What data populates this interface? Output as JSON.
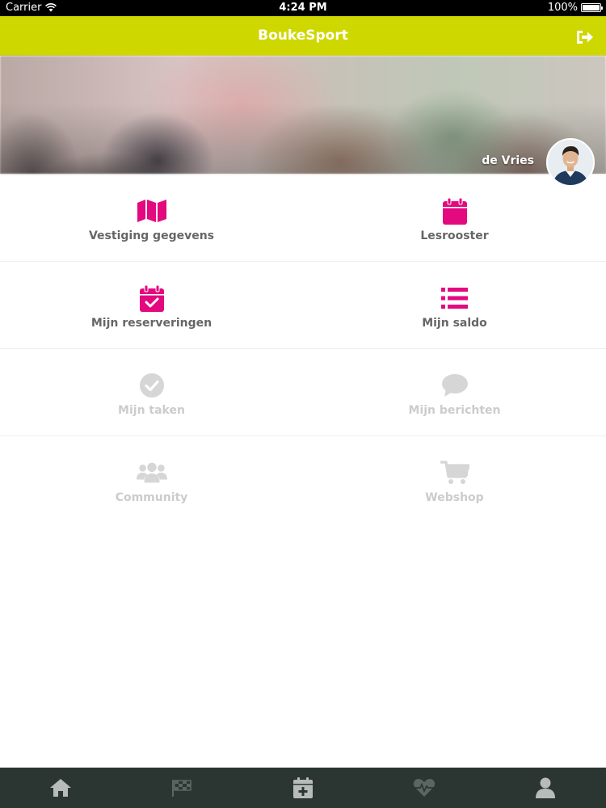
{
  "status_bar": {
    "carrier": "Carrier",
    "time": "4:24 PM",
    "battery": "100%"
  },
  "nav_bar": {
    "title": "BoukeSport",
    "logout_icon": "sign-out-icon",
    "color": "#cfd700"
  },
  "hero": {
    "user_name": "de Vries",
    "avatar_icon": "user-photo"
  },
  "accent_color": "#e3097f",
  "disabled_color": "#d6d6d6",
  "menu": [
    {
      "label": "Vestiging gegevens",
      "icon": "map-icon",
      "enabled": true
    },
    {
      "label": "Lesrooster",
      "icon": "calendar-icon",
      "enabled": true
    },
    {
      "label": "Mijn reserveringen",
      "icon": "calendar-check-icon",
      "enabled": true
    },
    {
      "label": "Mijn saldo",
      "icon": "list-icon",
      "enabled": true
    },
    {
      "label": "Mijn taken",
      "icon": "check-circle-icon",
      "enabled": false
    },
    {
      "label": "Mijn berichten",
      "icon": "chat-icon",
      "enabled": false
    },
    {
      "label": "Community",
      "icon": "users-icon",
      "enabled": false
    },
    {
      "label": "Webshop",
      "icon": "cart-icon",
      "enabled": false
    }
  ],
  "tab_bar": {
    "tabs": [
      {
        "icon": "home-icon",
        "active": true
      },
      {
        "icon": "flag-icon",
        "active": false
      },
      {
        "icon": "calendar-plus-icon",
        "active": true
      },
      {
        "icon": "heartbeat-icon",
        "active": false
      },
      {
        "icon": "user-icon",
        "active": true
      }
    ]
  }
}
